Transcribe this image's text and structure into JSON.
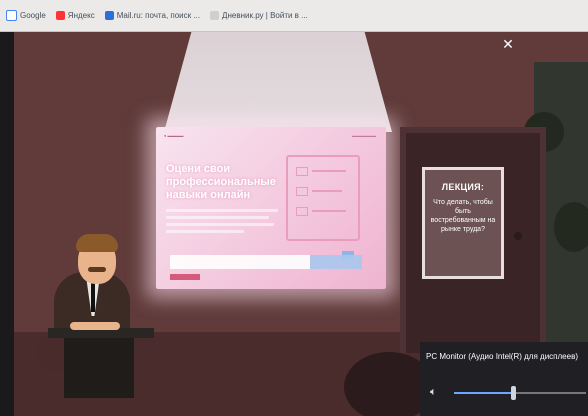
{
  "bookmarks": [
    {
      "label": "Google",
      "icon": "google-icon",
      "color": "#4285f4"
    },
    {
      "label": "Яндекс",
      "icon": "yandex-icon",
      "color": "#ff3333"
    },
    {
      "label": "Mail.ru: почта, поиск ...",
      "icon": "mailru-icon",
      "color": "#2c6fd6"
    },
    {
      "label": "Дневник.ру | Войти в ...",
      "icon": "dnevnik-icon",
      "color": "#cfcfcf"
    }
  ],
  "video": {
    "screen_title": "Оцени свои профессиональные навыки онлайн",
    "poster_heading": "ЛЕКЦИЯ:",
    "poster_text": "Что делать, чтобы быть востребованным на рынке труда?",
    "close_icon": "close-icon"
  },
  "volume": {
    "device": "PC Monitor (Аудио Intel(R) для дисплеев)",
    "icon": "speaker-icon",
    "level": 0.45,
    "accent": "#6aa7ff"
  }
}
